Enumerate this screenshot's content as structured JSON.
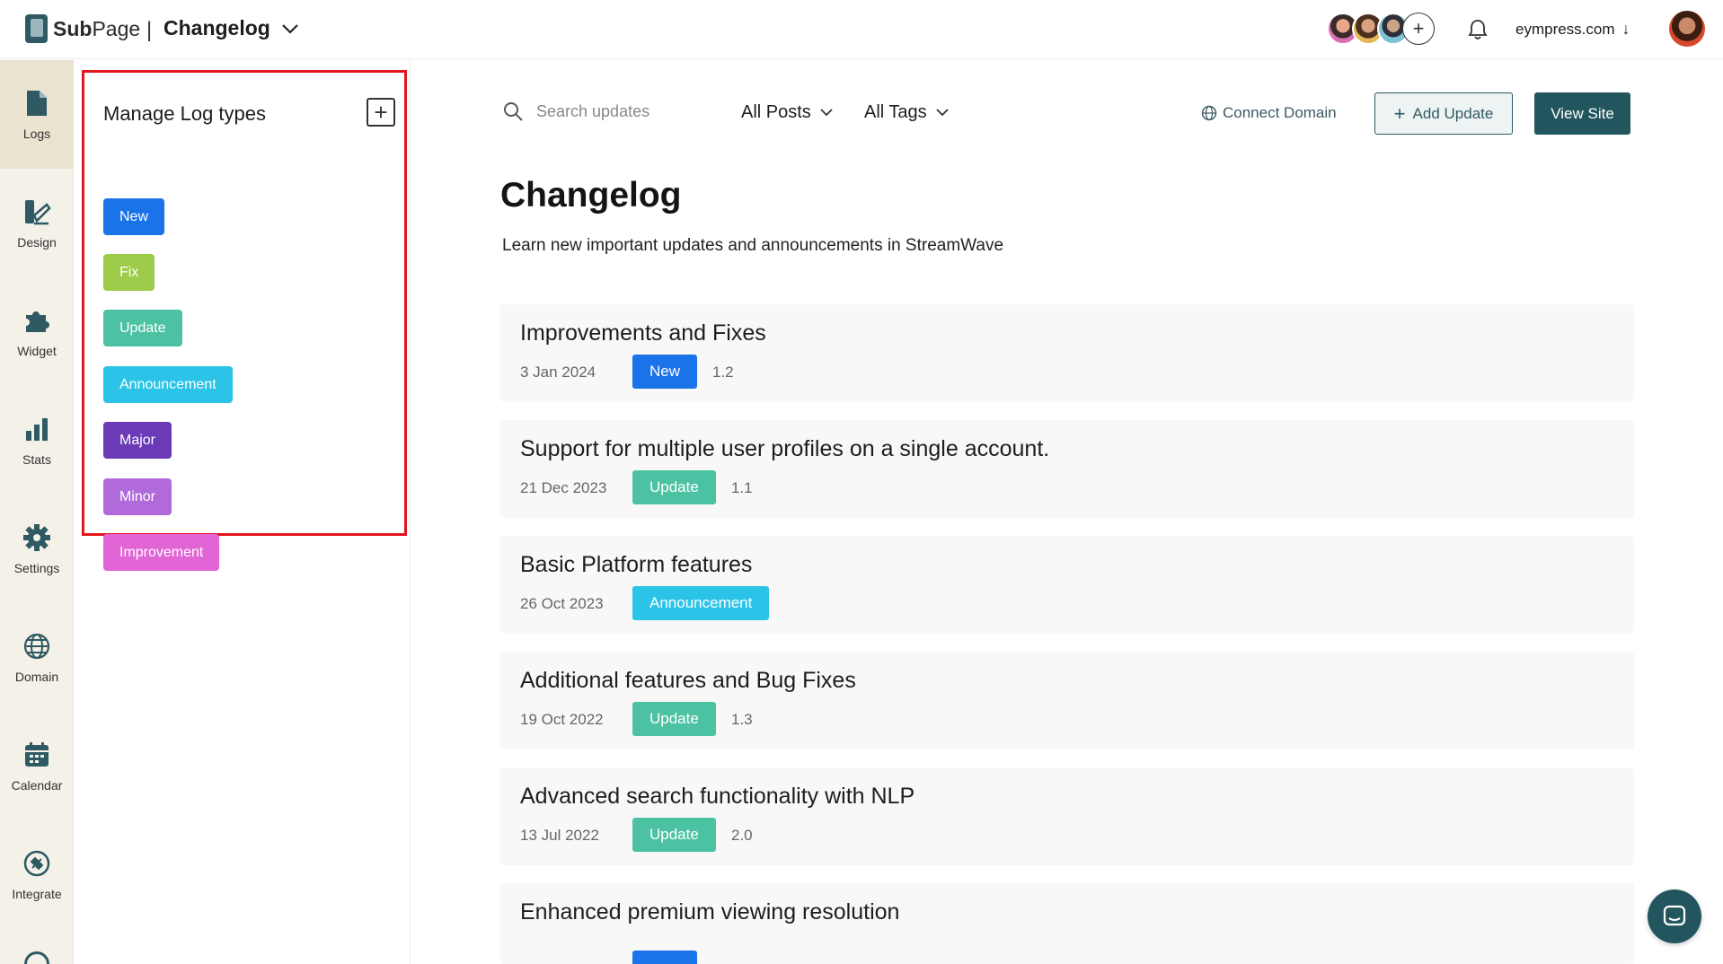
{
  "brand": {
    "name_bold": "Sub",
    "name_rest": "Page"
  },
  "header": {
    "breadcrumb": "Changelog",
    "site": "eympress.com",
    "site_arrow": "↓",
    "add_member": "+"
  },
  "rail": {
    "items": [
      {
        "label": "Logs",
        "icon": "document-icon"
      },
      {
        "label": "Design",
        "icon": "palette-icon"
      },
      {
        "label": "Widget",
        "icon": "puzzle-icon"
      },
      {
        "label": "Stats",
        "icon": "bar-chart-icon"
      },
      {
        "label": "Settings",
        "icon": "gear-icon"
      },
      {
        "label": "Domain",
        "icon": "globe-icon"
      },
      {
        "label": "Calendar",
        "icon": "calendar-icon"
      },
      {
        "label": "Integrate",
        "icon": "plug-icon"
      }
    ]
  },
  "manage": {
    "title": "Manage Log types",
    "add": "+",
    "types": [
      {
        "label": "New",
        "color": "#1a73e8"
      },
      {
        "label": "Fix",
        "color": "#9ccc4a"
      },
      {
        "label": "Update",
        "color": "#4cc2a3"
      },
      {
        "label": "Announcement",
        "color": "#2bc4e8"
      },
      {
        "label": "Major",
        "color": "#6a3ab7"
      },
      {
        "label": "Minor",
        "color": "#b06ad9"
      },
      {
        "label": "Improvement",
        "color": "#e265d6"
      }
    ]
  },
  "toolbar": {
    "search_placeholder": "Search updates",
    "filter_posts": "All Posts",
    "filter_tags": "All Tags",
    "connect_domain": "Connect Domain",
    "add_update": "Add Update",
    "add_update_plus": "+",
    "view_site": "View Site"
  },
  "page": {
    "title": "Changelog",
    "subtitle": "Learn new important updates and announcements in StreamWave"
  },
  "posts": [
    {
      "title": "Improvements and Fixes",
      "date": "3 Jan 2024",
      "tag": "New",
      "tag_color": "#1a73e8",
      "version": "1.2"
    },
    {
      "title": "Support for multiple user profiles on a single account.",
      "date": "21 Dec 2023",
      "tag": "Update",
      "tag_color": "#4cc2a3",
      "version": "1.1"
    },
    {
      "title": "Basic Platform features",
      "date": "26 Oct 2023",
      "tag": "Announcement",
      "tag_color": "#2bc4e8",
      "version": ""
    },
    {
      "title": "Additional features and Bug Fixes",
      "date": "19 Oct 2022",
      "tag": "Update",
      "tag_color": "#4cc2a3",
      "version": "1.3"
    },
    {
      "title": "Advanced search functionality with NLP",
      "date": "13 Jul 2022",
      "tag": "Update",
      "tag_color": "#4cc2a3",
      "version": "2.0"
    },
    {
      "title": "Enhanced premium viewing resolution",
      "date": "",
      "tag": "",
      "tag_color": "#1a73e8",
      "version": ""
    }
  ],
  "colors": {
    "accent": "#23555e",
    "highlight_border": "#e3141c",
    "rail_bg": "#f4f1e9"
  }
}
